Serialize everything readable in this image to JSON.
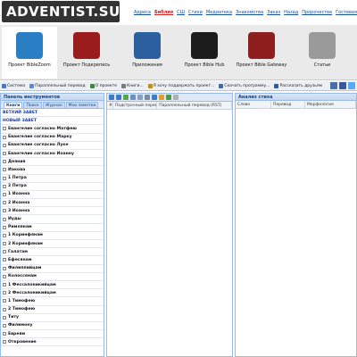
{
  "site": {
    "logo": "ADVENTIST.SU"
  },
  "topnav": [
    {
      "label": "Адреса"
    },
    {
      "label": "Библия",
      "active": true
    },
    {
      "label": "СШ"
    },
    {
      "label": "Стихи"
    },
    {
      "label": "Медиатека"
    },
    {
      "label": "Знакомства"
    },
    {
      "label": "Заказ"
    },
    {
      "label": "Назад"
    },
    {
      "label": "Пророчества"
    },
    {
      "label": "Гостевая"
    }
  ],
  "projects": [
    {
      "label": "Проект BibleZoom",
      "icon": "biblezoom-icon",
      "color": "#2a7fc4"
    },
    {
      "label": "Проект Подкрепись",
      "icon": "bible-food-icon",
      "color": "#9b1c1c"
    },
    {
      "label": "Приложения",
      "icon": "laptop-icon",
      "color": "#2c5f9e"
    },
    {
      "label": "Проект Bible Hub",
      "icon": "bible-hub-icon",
      "color": "#1c1c1c"
    },
    {
      "label": "Проект Bible Gateway",
      "icon": "gateway-icon",
      "color": "#8e1f1f"
    },
    {
      "label": "Статьи",
      "icon": "newspaper-icon",
      "color": "#9a9a9a"
    }
  ],
  "toolbar": {
    "items": [
      {
        "label": "Система",
        "color": "#4a78c0"
      },
      {
        "label": "Параллельный перевод",
        "color": "#5b8bd0"
      },
      {
        "label": "О проекте",
        "color": "#3a8a3a"
      },
      {
        "label": "Книги...",
        "color": "#7a7a7a"
      },
      {
        "label": "Я хочу поддержать проект...",
        "color": "#c08a20"
      },
      {
        "label": "Скачать программу...",
        "color": "#3a6ab0"
      },
      {
        "label": "Рассказать друзьям",
        "color": "#2a5ca8"
      }
    ],
    "icons": [
      {
        "name": "vk-icon",
        "color": "#4a6fa5"
      },
      {
        "name": "facebook-icon",
        "color": "#3b5998"
      },
      {
        "name": "share-icon",
        "color": "#55acee"
      }
    ]
  },
  "left_panel": {
    "title": "Панель инструментов",
    "tabs": [
      "Книги",
      "Поиск",
      "Журнал",
      "Мои заметки"
    ],
    "books": [
      {
        "label": "ВЕТХИЙ ЗАВЕТ",
        "testament": true
      },
      {
        "label": "НОВЫЙ ЗАВЕТ",
        "testament": true
      },
      {
        "label": "Евангелие согласно Матфею"
      },
      {
        "label": "Евангелие согласно Марку"
      },
      {
        "label": "Евангелие согласно Луке"
      },
      {
        "label": "Евангелие согласно Иоанну"
      },
      {
        "label": "Деяния"
      },
      {
        "label": "Иакова"
      },
      {
        "label": "1 Петра"
      },
      {
        "label": "2 Петра"
      },
      {
        "label": "1 Иоанна"
      },
      {
        "label": "2 Иоанна"
      },
      {
        "label": "3 Иоанна"
      },
      {
        "label": "Иуды"
      },
      {
        "label": "Римлянам"
      },
      {
        "label": "1 Коринфянам"
      },
      {
        "label": "2 Коринфянам"
      },
      {
        "label": "Галатам"
      },
      {
        "label": "Ефесянам"
      },
      {
        "label": "Филиппийцам"
      },
      {
        "label": "Колоссянам"
      },
      {
        "label": "1 Фессалоникийцам"
      },
      {
        "label": "2 Фессалоникийцам"
      },
      {
        "label": "1 Тимофею"
      },
      {
        "label": "2 Тимофею"
      },
      {
        "label": "Титу"
      },
      {
        "label": "Филимону"
      },
      {
        "label": "Евреям"
      },
      {
        "label": "Откровение"
      }
    ]
  },
  "middle_panel": {
    "tool_icons": [
      "back-icon",
      "forward-icon",
      "refresh-icon",
      "compare-icon",
      "copy-icon",
      "settings-icon",
      "search-icon",
      "print-icon",
      "note-icon",
      "help-icon"
    ],
    "columns": [
      "#",
      "Подстрочный перевод",
      "Параллельный перевод (RST)"
    ]
  },
  "right_panel": {
    "title": "Анализ стиха",
    "columns": [
      "Слово",
      "Перевод",
      "Морфология"
    ]
  }
}
